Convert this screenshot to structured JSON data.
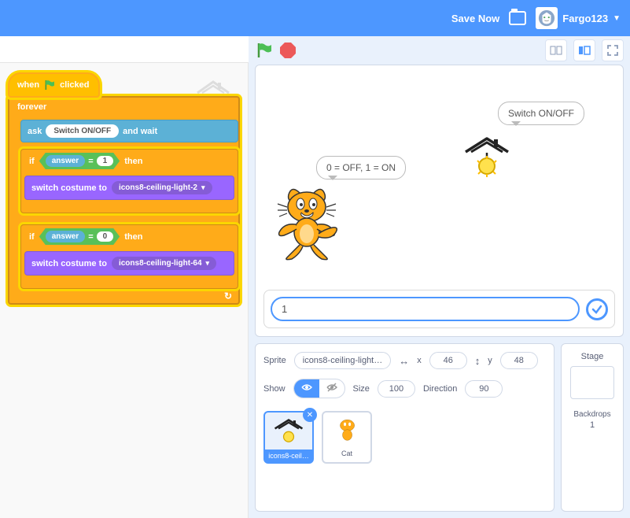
{
  "topbar": {
    "save": "Save Now",
    "username": "Fargo123"
  },
  "blocks": {
    "when_clicked": "when",
    "when_clicked2": "clicked",
    "forever": "forever",
    "ask": "ask",
    "ask_text": "Switch ON/OFF",
    "and_wait": "and wait",
    "if": "if",
    "then": "then",
    "answer": "answer",
    "eq": "=",
    "val1": "1",
    "val0": "0",
    "switch_costume": "switch costume to",
    "costume1": "icons8-ceiling-light-2",
    "costume2": "icons8-ceiling-light-64"
  },
  "stage": {
    "cat_says": "0 = OFF, 1 = ON",
    "light_says": "Switch ON/OFF",
    "answer_value": "1"
  },
  "sprite": {
    "label": "Sprite",
    "name": "icons8-ceiling-light…",
    "x_label": "x",
    "x": "46",
    "y_label": "y",
    "y": "48",
    "show": "Show",
    "size_label": "Size",
    "size": "100",
    "dir_label": "Direction",
    "dir": "90"
  },
  "thumbs": {
    "t1": "icons8-ceil…",
    "t2": "Cat"
  },
  "stage_panel": {
    "title": "Stage",
    "backdrops": "Backdrops",
    "count": "1"
  }
}
